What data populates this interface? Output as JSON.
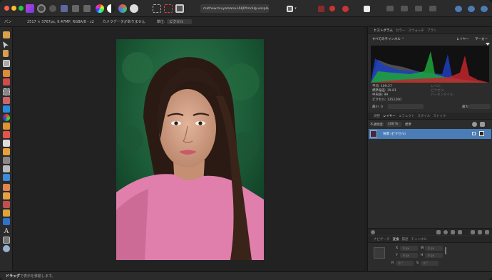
{
  "toolbar": {
    "filename": "mathew-tsuyamana-UHJ0YmcHg-unspla",
    "icons": [
      "app-logo-icon",
      "persona-photo-icon",
      "persona-liquify-icon",
      "persona-develop-icon",
      "persona-tone-map-icon",
      "persona-export-icon",
      "color-wheel-icon",
      "levels-icon",
      "hsl-icon",
      "white-balance-icon",
      "marquee-icon",
      "selection-brush-icon",
      "quick-mask-icon",
      "view-mode-icon",
      "snapping-icon",
      "text-tool-icon",
      "arrange-icon",
      "view-grid-icon",
      "studio-icon"
    ]
  },
  "context": {
    "units_label": "パン",
    "image_info": "2517 × 3767px, 9.47MP, RGBA/8 - c2",
    "camera_data": "カメラデータがありません",
    "unit_label": "単位:",
    "unit_value": "ピクセル"
  },
  "histogram": {
    "tabs": [
      "ヒストグラム",
      "カラー",
      "スウォッチ",
      "ブラシ"
    ],
    "channel_select": "すべてのチャンネル",
    "layer_button": "レイヤー",
    "marker_button": "マーカー",
    "stats_left": [
      "平均: 109.27",
      "標準偏差: 39.81",
      "中央値: 99",
      "ピクセル: 1351260"
    ],
    "stats_right": [
      "レベル:",
      "ピクセル:",
      "パーセンタイル:"
    ],
    "min_label": "最小: 0",
    "max_label": "最大: 1"
  },
  "layers": {
    "tabs": [
      "調整",
      "レイヤー",
      "エフェクト",
      "スタイル",
      "ストック"
    ],
    "opacity_label": "不透明度:",
    "opacity_value": "100 %",
    "blend_mode": "標準",
    "layer_name": "背景 (ピクセル)"
  },
  "transform": {
    "tabs": [
      "ナビゲータ",
      "変換",
      "履歴",
      "チャンネル"
    ],
    "fields": [
      {
        "label": "X",
        "value": "0 px"
      },
      {
        "label": "W",
        "value": "0 px"
      },
      {
        "label": "Y",
        "value": "0 px"
      },
      {
        "label": "H",
        "value": "0 px"
      },
      {
        "label": "R",
        "value": "0 °"
      },
      {
        "label": "S",
        "value": "0 °"
      }
    ]
  },
  "status": {
    "drag_label": "ドラッグ",
    "drag_hint": "で表示を移動します。"
  },
  "colors": {
    "accent": "#4a7db5",
    "panel": "#2c2c2c",
    "background": "#1f1f1f"
  },
  "hist_colors": {
    "blue": "#1c3fbf",
    "green": "#1fa33a",
    "red": "#c2262b",
    "gray": "#8a8a8a"
  }
}
